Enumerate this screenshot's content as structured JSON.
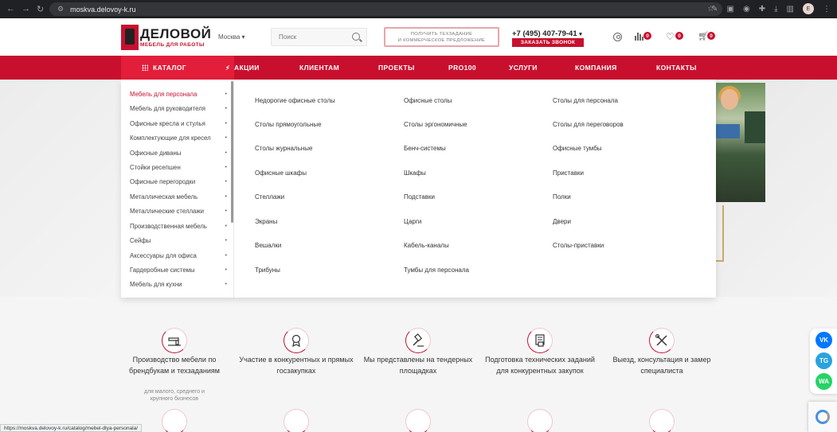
{
  "browser": {
    "url": "moskva.delovoy-k.ru",
    "status_url": "https://moskva.delovoy-k.ru/catalog/mebel-dlya-personala/",
    "profile_initial": "E"
  },
  "header": {
    "logo_name": "ДЕЛОВОЙ",
    "logo_sub": "МЕБЕЛЬ ДЛЯ РАБОТЫ",
    "city": "Москва",
    "search_placeholder": "Поиск",
    "tz_line1": "ПОЛУЧИТЬ ТЕХЗАДАНИЕ",
    "tz_line2": "И КОММЕРЧЕСКОЕ ПРЕДЛОЖЕНИЕ",
    "phone": "+7 (495) 407-79-41",
    "call_button": "ЗАКАЗАТЬ ЗВОНОК",
    "badges": {
      "compare": "0",
      "favorites": "0",
      "cart": "0"
    }
  },
  "menu": {
    "catalog": "КАТАЛОГ",
    "items": [
      "АКЦИИ",
      "КЛИЕНТАМ",
      "ПРОЕКТЫ",
      "PRO100",
      "УСЛУГИ",
      "КОМПАНИЯ",
      "КОНТАКТЫ"
    ]
  },
  "catalog_side": [
    "Мебель для персонала",
    "Мебель для руководителя",
    "Офисные кресла и стулья",
    "Комплектующие для кресел",
    "Офисные диваны",
    "Стойки ресепшен",
    "Офисные перегородки",
    "Металлическая мебель",
    "Металлические стеллажи",
    "Производственная мебель",
    "Сейфы",
    "Аксессуары для офиса",
    "Гардеробные системы",
    "Мебель для кухни"
  ],
  "subcategories": {
    "col1": [
      "Недорогие офисные столы",
      "Столы прямоугольные",
      "Столы журнальные",
      "Офисные шкафы",
      "Стеллажи",
      "Экраны",
      "Вешалки",
      "Трибуны"
    ],
    "col2": [
      "Офисные столы",
      "Столы эргономичные",
      "Бенч-системы",
      "Шкафы",
      "Подставки",
      "Царги",
      "Кабель-каналы",
      "Тумбы для персонала"
    ],
    "col3": [
      "Столы для персонала",
      "Столы для переговоров",
      "Офисные тумбы",
      "Приставки",
      "Полки",
      "Двери",
      "Столы-приставки"
    ]
  },
  "features": [
    {
      "icon": "sewing-machine-icon",
      "title": "Производство мебели по брендбукам и техзаданиям",
      "subtitle": "для малого, среднего и крупного бизнесов"
    },
    {
      "icon": "medal-icon",
      "title": "Участие в конкурентных и прямых госзакупках",
      "subtitle": ""
    },
    {
      "icon": "gavel-icon",
      "title": "Мы представлены на тендерных площадках",
      "subtitle": ""
    },
    {
      "icon": "document-stamp-icon",
      "title": "Подготовка технических заданий для конкурентных закупок",
      "subtitle": ""
    },
    {
      "icon": "tools-icon",
      "title": "Выезд, консультация и замер специалиста",
      "subtitle": ""
    }
  ],
  "social": {
    "vk": "VK",
    "telegram": "TG",
    "whatsapp": "WA"
  },
  "colors": {
    "brand_red": "#c8102e",
    "catalog_red": "#e31e3a",
    "vk": "#0077ff",
    "telegram": "#2aa3df",
    "whatsapp": "#25d366"
  }
}
